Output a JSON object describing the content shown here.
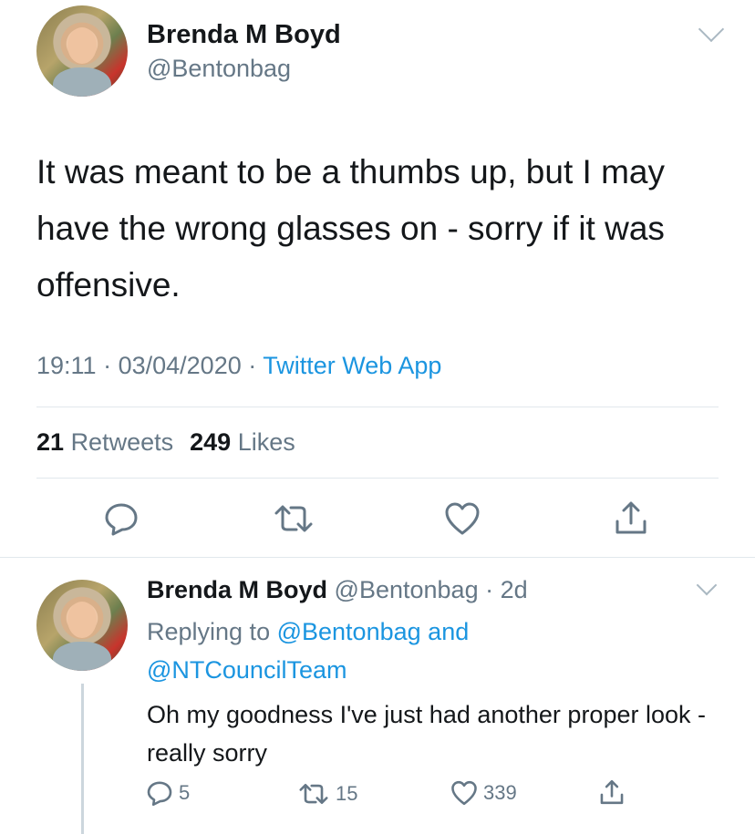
{
  "tweet": {
    "author_name": "Brenda M Boyd",
    "author_handle": "@Bentonbag",
    "text": "It was meant to be a thumbs up, but I may have the wrong glasses on - sorry if it was offensive.",
    "time": "19:11",
    "date": "03/04/2020",
    "separator": "·",
    "source": "Twitter Web App",
    "retweets_count": "21",
    "retweets_label": "Retweets",
    "likes_count": "249",
    "likes_label": "Likes"
  },
  "reply": {
    "author_name": "Brenda M Boyd",
    "author_handle": "@Bentonbag",
    "age": "· 2d",
    "replying_to_prefix": "Replying to",
    "replying_to_user1": "@Bentonbag",
    "replying_to_and": "and",
    "replying_to_user2": "@NTCouncilTeam",
    "text": "Oh my goodness I've just had another proper look - really sorry",
    "reply_count": "5",
    "retweet_count": "15",
    "like_count": "339"
  },
  "icons": {
    "reply": "reply-icon",
    "retweet": "retweet-icon",
    "like": "heart-icon",
    "share": "share-icon",
    "menu": "chevron-down-icon"
  },
  "colors": {
    "text": "#14171a",
    "muted": "#657786",
    "link": "#1b95e0",
    "divider": "#e1e8ed"
  }
}
